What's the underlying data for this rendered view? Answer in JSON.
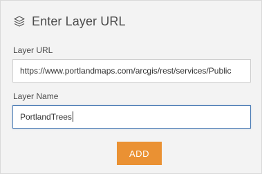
{
  "dialog": {
    "title": "Enter Layer URL",
    "icon": "layers-icon"
  },
  "form": {
    "layer_url": {
      "label": "Layer URL",
      "value": "https://www.portlandmaps.com/arcgis/rest/services/Public"
    },
    "layer_name": {
      "label": "Layer Name",
      "value": "PortlandTrees"
    },
    "add_button_label": "ADD"
  },
  "colors": {
    "accent": "#ea9133",
    "focus_border": "#4d7db6",
    "panel_bg": "#f3f3f3"
  }
}
